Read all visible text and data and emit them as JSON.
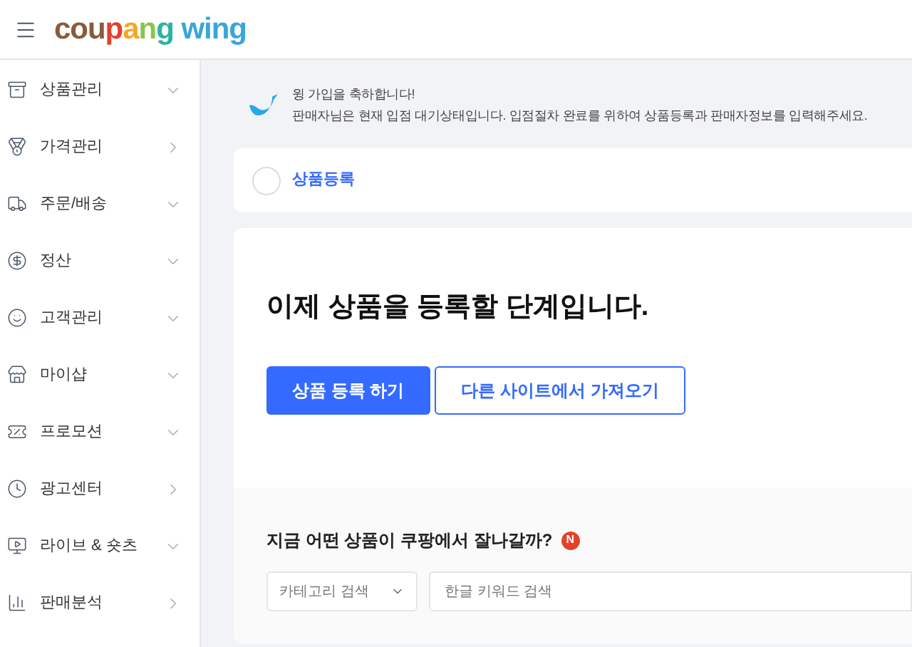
{
  "header": {
    "logo": "coupang wing"
  },
  "sidebar": {
    "items": [
      {
        "label": "상품관리",
        "kind": "menu"
      },
      {
        "label": "가격관리",
        "kind": "link"
      },
      {
        "label": "주문/배송",
        "kind": "menu"
      },
      {
        "label": "정산",
        "kind": "menu"
      },
      {
        "label": "고객관리",
        "kind": "menu"
      },
      {
        "label": "마이샵",
        "kind": "menu"
      },
      {
        "label": "프로모션",
        "kind": "menu"
      },
      {
        "label": "광고센터",
        "kind": "link"
      },
      {
        "label": "라이브 & 숏츠",
        "kind": "menu"
      },
      {
        "label": "판매분석",
        "kind": "link"
      }
    ]
  },
  "welcome": {
    "title": "윙 가입을 축하합니다!",
    "message": "판매자님은 현재 입점 대기상태입니다. 입점절차 완료를 위하여 상품등록과 판매자정보를 입력해주세요."
  },
  "step": {
    "label": "상품등록",
    "checked": false
  },
  "register": {
    "heading": "이제 상품을 등록할 단계입니다.",
    "buttons": [
      {
        "label": "상품 등록 하기",
        "kind": "primary"
      },
      {
        "label": "다른 사이트에서 가져오기",
        "kind": "outline"
      }
    ]
  },
  "trend": {
    "heading": "지금 어떤 상품이 쿠팡에서 잘나갈까?",
    "badge": "N",
    "category": {
      "placeholder": "카테고리 검색"
    },
    "keyword": {
      "placeholder": "한글 키워드 검색"
    }
  }
}
